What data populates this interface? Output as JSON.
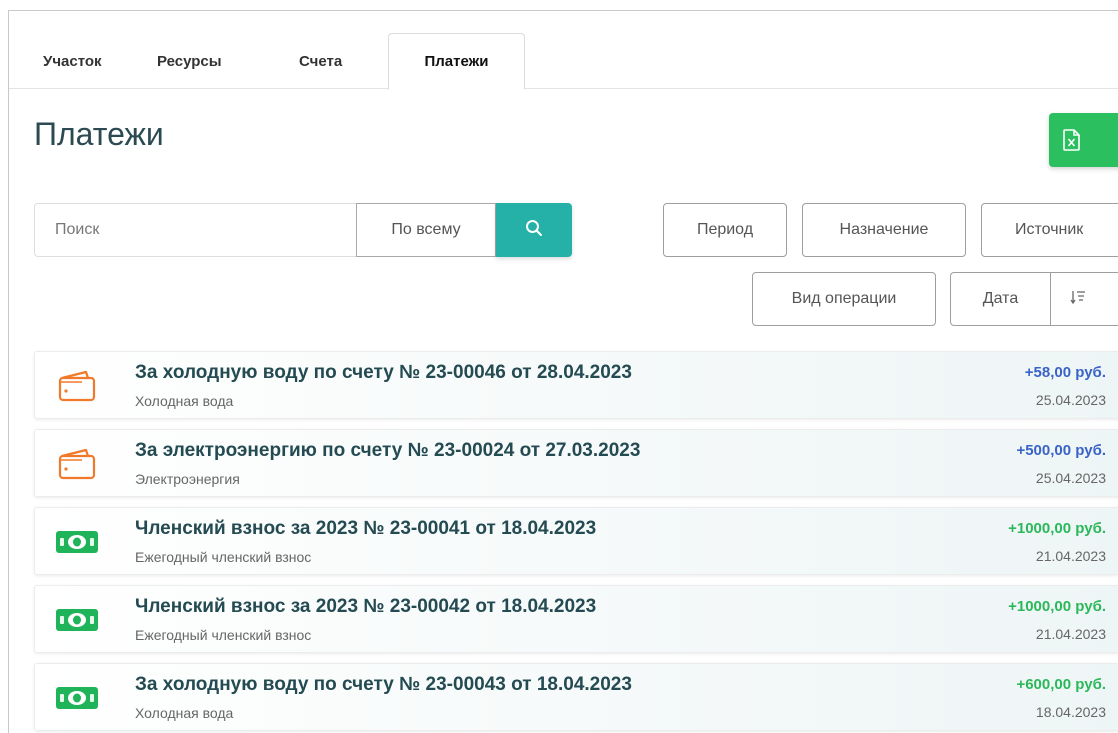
{
  "tabs": [
    {
      "label": "Участок"
    },
    {
      "label": "Ресурсы"
    },
    {
      "label": "Счета"
    },
    {
      "label": "Платежи",
      "active": true
    }
  ],
  "page_title": "Платежи",
  "search": {
    "placeholder": "Поиск",
    "scope": "По всему"
  },
  "filters": {
    "period": "Период",
    "purpose": "Назначение",
    "source": "Источник",
    "operation_type": "Вид операции",
    "sort_field": "Дата"
  },
  "colors": {
    "accent_green": "#2bbf5f",
    "teal": "#26b1a8",
    "amount_blue": "#3a63c8",
    "amount_green": "#2bb85a",
    "wallet_orange": "#f07a2a",
    "cash_green": "#1fb45a"
  },
  "payments": [
    {
      "icon": "wallet-icon",
      "title": "За холодную воду по счету № 23-00046 от 28.04.2023",
      "subtitle": "Холодная вода",
      "amount": "+58,00 руб.",
      "amount_color": "blue",
      "date": "25.04.2023"
    },
    {
      "icon": "wallet-icon",
      "title": "За электроэнергию по счету № 23-00024 от 27.03.2023",
      "subtitle": "Электроэнергия",
      "amount": "+500,00 руб.",
      "amount_color": "blue",
      "date": "25.04.2023"
    },
    {
      "icon": "cash-icon",
      "title": "Членский взнос за 2023 № 23-00041 от 18.04.2023",
      "subtitle": "Ежегодный членский взнос",
      "amount": "+1000,00 руб.",
      "amount_color": "green",
      "date": "21.04.2023"
    },
    {
      "icon": "cash-icon",
      "title": "Членский взнос за 2023 № 23-00042 от 18.04.2023",
      "subtitle": "Ежегодный членский взнос",
      "amount": "+1000,00 руб.",
      "amount_color": "green",
      "date": "21.04.2023"
    },
    {
      "icon": "cash-icon",
      "title": "За холодную воду по счету № 23-00043 от 18.04.2023",
      "subtitle": "Холодная вода",
      "amount": "+600,00 руб.",
      "amount_color": "green",
      "date": "18.04.2023"
    }
  ]
}
